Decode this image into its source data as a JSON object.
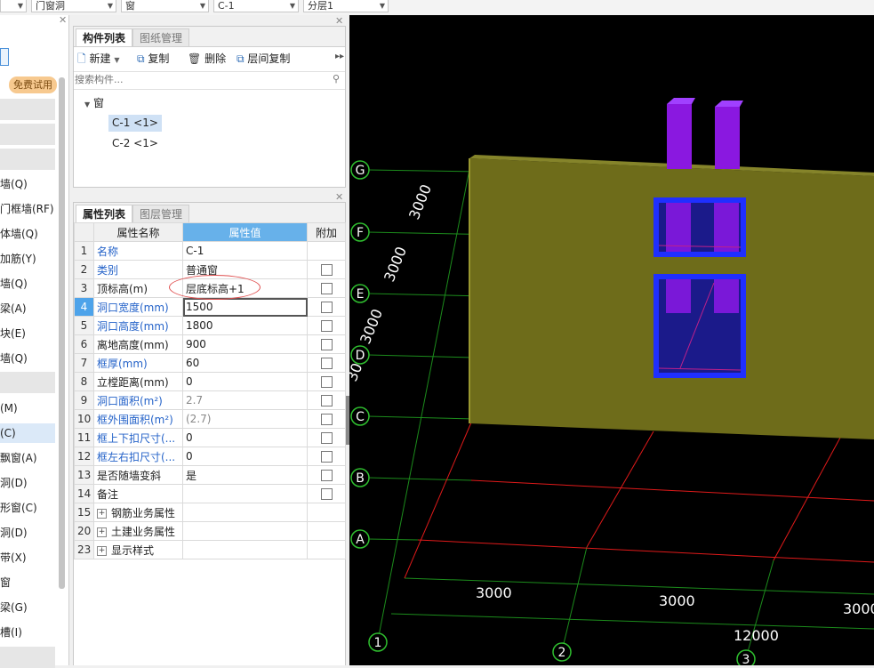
{
  "toolbar": {
    "combos": [
      "",
      "门窗洞",
      "窗",
      "C-1",
      "分层1"
    ]
  },
  "left_sidebar": {
    "free_trial": "免费试用",
    "items": [
      "墙(Q)",
      "门框墙(RF)",
      "体墙(Q)",
      "加筋(Y)",
      "墙(Q)",
      "梁(A)",
      "块(E)",
      "墙(Q)",
      "(M)",
      "(C)",
      "飘窗(A)",
      "洞(D)",
      "形窗(C)",
      "洞(D)",
      "带(X)",
      "窗",
      "梁(G)",
      "槽(I)"
    ]
  },
  "component_panel": {
    "tabs": [
      "构件列表",
      "图纸管理"
    ],
    "actions": {
      "new": "新建",
      "copy": "复制",
      "delete": "删除",
      "floor_copy": "层间复制"
    },
    "search_placeholder": "搜索构件...",
    "tree_root": "窗",
    "tree_items": [
      "C-1 <1>",
      "C-2 <1>"
    ]
  },
  "property_panel": {
    "tabs": [
      "属性列表",
      "图层管理"
    ],
    "headers": {
      "name": "属性名称",
      "value": "属性值",
      "extra": "附加"
    },
    "rows": [
      {
        "num": "1",
        "name": "名称",
        "value": "C-1",
        "blue": true,
        "chk": false
      },
      {
        "num": "2",
        "name": "类别",
        "value": "普通窗",
        "blue": true,
        "chk": true
      },
      {
        "num": "3",
        "name": "顶标高(m)",
        "value": "层底标高+1",
        "blue": false,
        "chk": true
      },
      {
        "num": "4",
        "name": "洞口宽度(mm)",
        "value": "1500",
        "blue": true,
        "chk": true
      },
      {
        "num": "5",
        "name": "洞口高度(mm)",
        "value": "1800",
        "blue": true,
        "chk": true
      },
      {
        "num": "6",
        "name": "离地高度(mm)",
        "value": "900",
        "blue": false,
        "chk": true
      },
      {
        "num": "7",
        "name": "框厚(mm)",
        "value": "60",
        "blue": true,
        "chk": true
      },
      {
        "num": "8",
        "name": "立樘距离(mm)",
        "value": "0",
        "blue": false,
        "chk": true
      },
      {
        "num": "9",
        "name": "洞口面积(m²)",
        "value": "2.7",
        "blue": true,
        "chk": true,
        "gray": true
      },
      {
        "num": "10",
        "name": "框外围面积(m²)",
        "value": "(2.7)",
        "blue": true,
        "chk": true,
        "gray": true
      },
      {
        "num": "11",
        "name": "框上下扣尺寸(...",
        "value": "0",
        "blue": true,
        "chk": true
      },
      {
        "num": "12",
        "name": "框左右扣尺寸(...",
        "value": "0",
        "blue": true,
        "chk": true
      },
      {
        "num": "13",
        "name": "是否随墙变斜",
        "value": "是",
        "blue": false,
        "chk": true
      },
      {
        "num": "14",
        "name": "备注",
        "value": "",
        "blue": false,
        "chk": true
      },
      {
        "num": "15",
        "name": "钢筋业务属性",
        "value": "",
        "group": true
      },
      {
        "num": "20",
        "name": "土建业务属性",
        "value": "",
        "group": true
      },
      {
        "num": "23",
        "name": "显示样式",
        "value": "",
        "group": true
      }
    ]
  },
  "viewport": {
    "axis_labels": [
      "G",
      "F",
      "E",
      "D",
      "C",
      "B",
      "A",
      "1",
      "2",
      "3"
    ],
    "dims": [
      "3000",
      "3000",
      "3000",
      "3000",
      "3000",
      "3000",
      "12000",
      "30"
    ]
  }
}
